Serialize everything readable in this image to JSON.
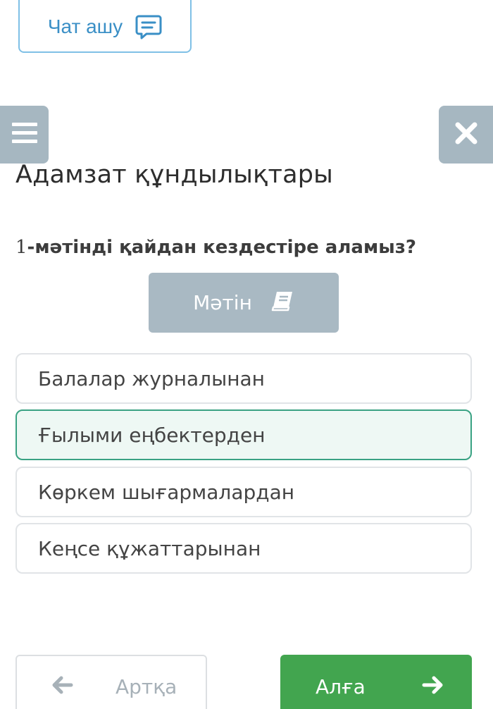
{
  "header": {
    "chat_button_label": "Чат ашу",
    "chat_icon": "chat-bubble-icon",
    "menu_icon": "hamburger-menu-icon",
    "close_icon": "close-icon"
  },
  "lesson": {
    "title": "Адамзат құндылықтары"
  },
  "question": {
    "number": "1",
    "text": "-мәтінді қайдан кездестіре аламыз?"
  },
  "text_button": {
    "label": "Мәтін",
    "icon": "book-icon"
  },
  "options": [
    {
      "label": "Балалар журналынан",
      "selected": false
    },
    {
      "label": "Ғылыми еңбектерден",
      "selected": true
    },
    {
      "label": "Көркем шығармалардан",
      "selected": false
    },
    {
      "label": "Кеңсе құжаттарынан",
      "selected": false
    }
  ],
  "navigation": {
    "back_label": "Артқа",
    "back_icon": "arrow-left-icon",
    "next_label": "Алға",
    "next_icon": "arrow-right-icon"
  },
  "colors": {
    "chat_accent": "#3a8fc6",
    "grey_button": "#a9b9c3",
    "selected_border": "#3aa283",
    "selected_bg": "#eef8f4",
    "next_green": "#42a54f"
  }
}
